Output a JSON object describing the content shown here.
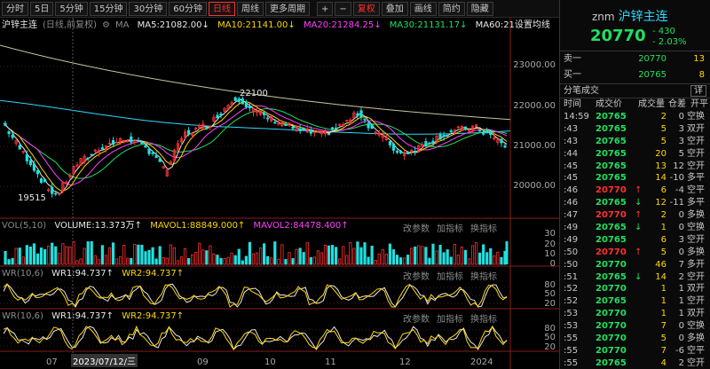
{
  "toolbar": {
    "items": [
      "分时",
      "5日",
      "5分钟",
      "15分钟",
      "30分钟",
      "60分钟",
      "日线",
      "周线",
      "更多周期",
      "+",
      "−",
      "复权",
      "叠加",
      "画线",
      "简约",
      "隐藏"
    ],
    "active": "日线"
  },
  "price_info": {
    "name": "沪锌主连",
    "adj": "(日线,前复权)",
    "ma": "MA",
    "ma5": "MA5:21082.00↓",
    "ma10": "MA10:21141.00↓",
    "ma20": "MA20:21284.25↓",
    "ma30": "MA30:21131.17↓",
    "ma60": "MA60:21",
    "settings": "设置均线"
  },
  "vol_info": {
    "label": "VOL(5,10)",
    "volume": "VOLUME:13.373万↑",
    "mavol1": "MAVOL1:88849.000↑",
    "mavol2": "MAVOL2:84478.400↑"
  },
  "wr1_info": {
    "label": "WR(10,6)",
    "wr1": "WR1:94.737↑",
    "wr2": "WR2:94.737↑"
  },
  "wr2_info": {
    "label": "WR(10,6)",
    "wr1": "WR1:94.737↑",
    "wr2": "WR2:94.737↑"
  },
  "panel_buttons": [
    "改参数",
    "加指标",
    "换指标"
  ],
  "price_axis": [
    "23000.00",
    "22000.00",
    "21000.00",
    "20000.00"
  ],
  "vol_axis": [
    "30",
    "20",
    "10",
    "0"
  ],
  "wr_axis": [
    "80",
    "50",
    "20"
  ],
  "annotations": {
    "high": "22100",
    "low": "19515"
  },
  "dates": [
    "07",
    "2023/07/12/三",
    "09",
    "10",
    "11",
    "12",
    "2024"
  ],
  "chart_data": {
    "type": "candlestick",
    "title": "沪锌主连",
    "ylim": [
      19000,
      23800
    ],
    "high_label": 22100,
    "low_label": 19515,
    "last_close": 20770,
    "ma_values": {
      "MA5": 21082.0,
      "MA10": 21141.0,
      "MA20": 21284.25,
      "MA30": 21131.17
    }
  },
  "side": {
    "code": "znm",
    "name": "沪锌主连",
    "price": "20770",
    "change": "- 430",
    "change_pct": "- 2.03%",
    "sell_label": "卖一",
    "sell_price": "20770",
    "sell_qty": "13",
    "buy_label": "买一",
    "buy_price": "20765",
    "buy_qty": "8",
    "ticks_title": "分笔成交",
    "detail_btn": "详",
    "columns": [
      "时间",
      "成交价",
      "成交量",
      "仓差",
      "开平"
    ],
    "ticks": [
      {
        "t": "14:59",
        "p": "20765",
        "a": "",
        "v": "2",
        "o": "0",
        "n": "空换"
      },
      {
        "t": ":43",
        "p": "20765",
        "a": "",
        "v": "5",
        "o": "3",
        "n": "双开"
      },
      {
        "t": ":43",
        "p": "20765",
        "a": "",
        "v": "5",
        "o": "3",
        "n": "空开"
      },
      {
        "t": ":44",
        "p": "20765",
        "a": "",
        "v": "20",
        "o": "5",
        "n": "空开"
      },
      {
        "t": ":45",
        "p": "20765",
        "a": "",
        "v": "13",
        "o": "12",
        "n": "空开"
      },
      {
        "t": ":45",
        "p": "20765",
        "a": "",
        "v": "14",
        "o": "-10",
        "n": "多平"
      },
      {
        "t": ":46",
        "p": "20770",
        "a": "↑",
        "v": "6",
        "o": "-4",
        "n": "空平"
      },
      {
        "t": ":46",
        "p": "20765",
        "a": "↓",
        "v": "12",
        "o": "-11",
        "n": "多平"
      },
      {
        "t": ":47",
        "p": "20770",
        "a": "↑",
        "v": "2",
        "o": "0",
        "n": "多换"
      },
      {
        "t": ":49",
        "p": "20765",
        "a": "↓",
        "v": "1",
        "o": "0",
        "n": "空换"
      },
      {
        "t": ":49",
        "p": "20765",
        "a": "",
        "v": "6",
        "o": "3",
        "n": "空开"
      },
      {
        "t": ":50",
        "p": "20770",
        "a": "↑",
        "v": "5",
        "o": "0",
        "n": "多换"
      },
      {
        "t": ":50",
        "p": "20770",
        "a": "",
        "v": "46",
        "o": "7",
        "n": "多开"
      },
      {
        "t": ":51",
        "p": "20765",
        "a": "↓",
        "v": "14",
        "o": "2",
        "n": "空开"
      },
      {
        "t": ":52",
        "p": "20770",
        "a": "",
        "v": "1",
        "o": "1",
        "n": "双开"
      },
      {
        "t": ":52",
        "p": "20765",
        "a": "",
        "v": "1",
        "o": "1",
        "n": "空开"
      },
      {
        "t": ":53",
        "p": "20770",
        "a": "",
        "v": "1",
        "o": "1",
        "n": "双开"
      },
      {
        "t": ":53",
        "p": "20770",
        "a": "",
        "v": "7",
        "o": "0",
        "n": "空换"
      },
      {
        "t": ":55",
        "p": "20770",
        "a": "",
        "v": "5",
        "o": "0",
        "n": "多换"
      },
      {
        "t": ":55",
        "p": "20770",
        "a": "",
        "v": "7",
        "o": "-6",
        "n": "空平"
      },
      {
        "t": ":55",
        "p": "20765",
        "a": "",
        "v": "4",
        "o": "2",
        "n": "空开"
      },
      {
        "t": ":56",
        "p": "20765",
        "a": "",
        "v": "5",
        "o": "4",
        "n": "空开"
      }
    ]
  }
}
